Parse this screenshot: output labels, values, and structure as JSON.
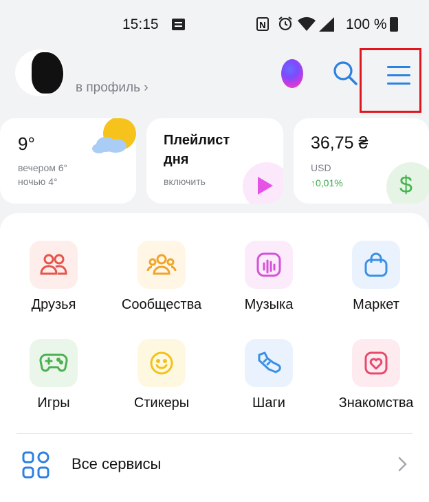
{
  "status_bar": {
    "time": "15:15",
    "battery": "100 %",
    "nfc_letter": "N"
  },
  "header": {
    "profile_link": "в профиль ›"
  },
  "widgets": {
    "weather": {
      "temperature": "9°",
      "evening": "вечером 6°",
      "night": "ночью 4°"
    },
    "playlist": {
      "title_line1": "Плейлист",
      "title_line2": "дня",
      "action": "включить"
    },
    "currency": {
      "value": "36,75 ₴",
      "code": "USD",
      "change": "↑0,01%",
      "symbol": "$"
    }
  },
  "services": [
    {
      "label": "Друзья",
      "color": "#e8534a",
      "bg": "#fdeeec",
      "icon": "friends-icon"
    },
    {
      "label": "Сообщества",
      "color": "#f0a429",
      "bg": "#fff6e6",
      "icon": "communities-icon"
    },
    {
      "label": "Музыка",
      "color": "#d651d9",
      "bg": "#fbebfb",
      "icon": "music-icon"
    },
    {
      "label": "Маркет",
      "color": "#3a8fe6",
      "bg": "#eaf3fd",
      "icon": "market-icon"
    },
    {
      "label": "Игры",
      "color": "#4cb050",
      "bg": "#eaf6ea",
      "icon": "games-icon"
    },
    {
      "label": "Стикеры",
      "color": "#f2c21b",
      "bg": "#fff8e1",
      "icon": "stickers-icon"
    },
    {
      "label": "Шаги",
      "color": "#3a8fe6",
      "bg": "#eaf3fd",
      "icon": "steps-icon"
    },
    {
      "label": "Знакомства",
      "color": "#e84a6e",
      "bg": "#fdebef",
      "icon": "dating-icon"
    }
  ],
  "all_services": {
    "label": "Все сервисы",
    "color": "#2d81e0"
  }
}
